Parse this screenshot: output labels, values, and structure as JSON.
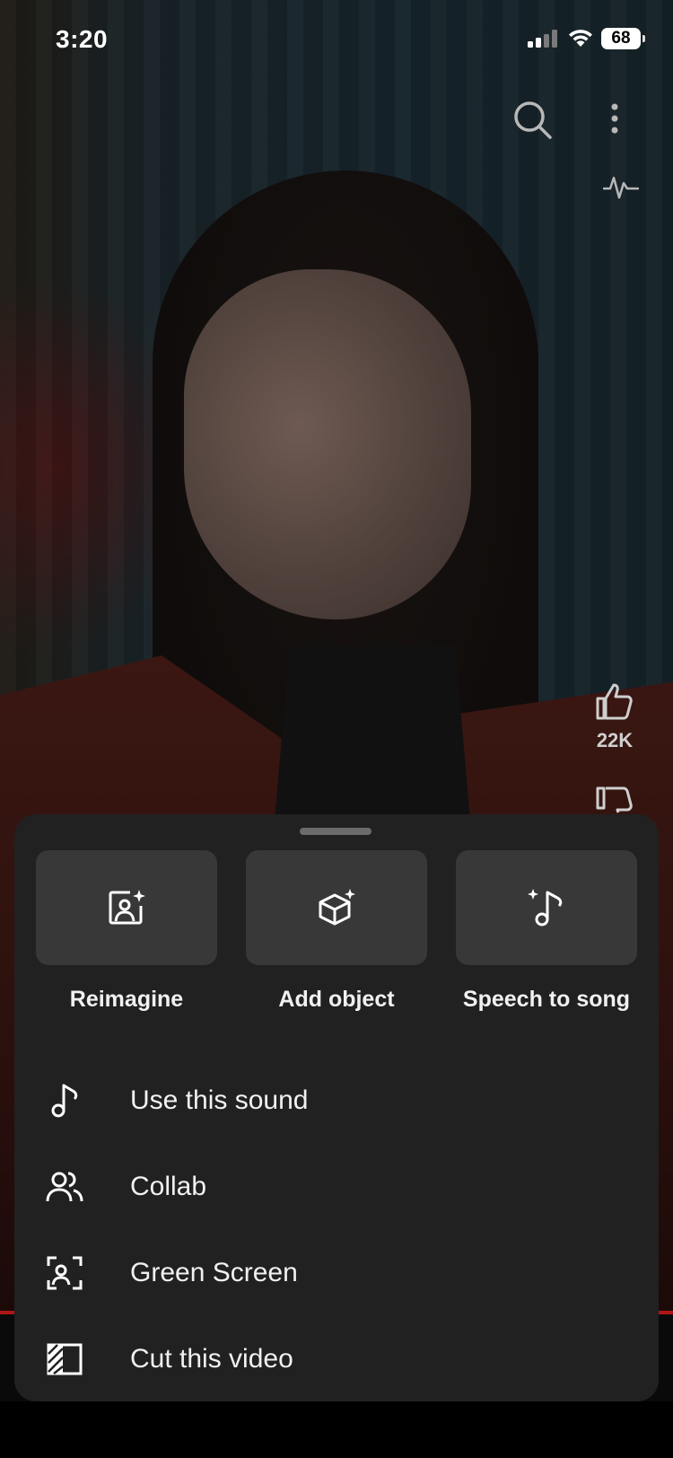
{
  "status_bar": {
    "time": "3:20",
    "battery": "68"
  },
  "video": {
    "like_count": "22K"
  },
  "sheet": {
    "tiles": [
      {
        "label": "Reimagine",
        "icon": "reimagine-icon"
      },
      {
        "label": "Add object",
        "icon": "add-object-icon"
      },
      {
        "label": "Speech to song",
        "icon": "speech-to-song-icon"
      }
    ],
    "items": [
      {
        "label": "Use this sound",
        "icon": "music-note-icon"
      },
      {
        "label": "Collab",
        "icon": "collab-icon"
      },
      {
        "label": "Green Screen",
        "icon": "green-screen-icon"
      },
      {
        "label": "Cut this video",
        "icon": "cut-video-icon"
      }
    ]
  },
  "colors": {
    "sheet_bg": "#212121",
    "tile_bg": "#383838",
    "progress_red": "#b01515"
  }
}
